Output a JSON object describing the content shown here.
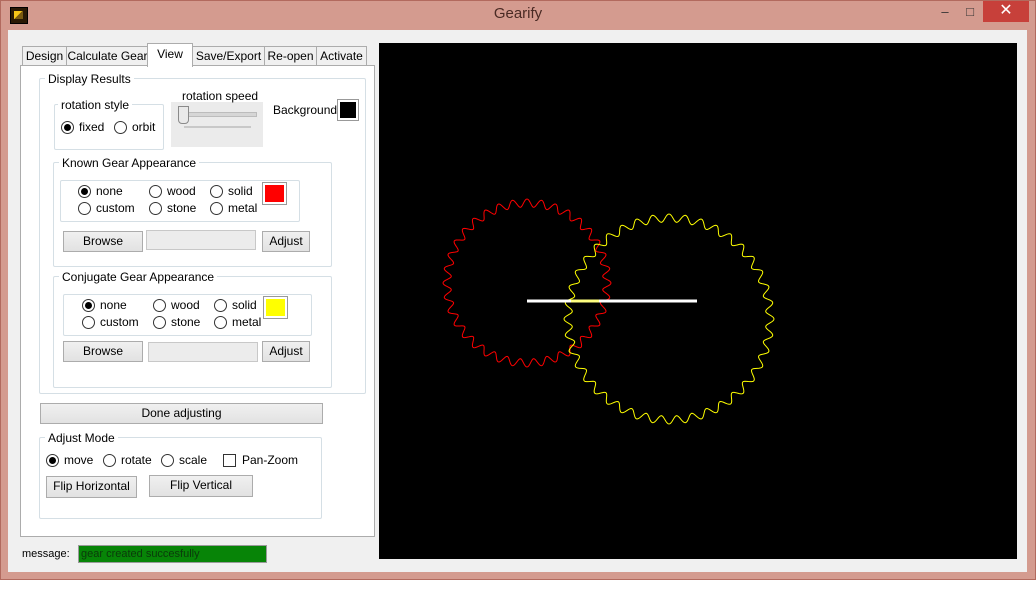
{
  "window": {
    "title": "Gearify"
  },
  "titlebar": {
    "minimize_glyph": "–",
    "maximize_glyph": "□",
    "close_glyph": "✕"
  },
  "tabs": [
    {
      "label": "Design"
    },
    {
      "label": "Calculate Gear"
    },
    {
      "label": "View",
      "active": true
    },
    {
      "label": "Save/Export"
    },
    {
      "label": "Re-open"
    },
    {
      "label": "Activate"
    }
  ],
  "display_results": {
    "label": "Display Results",
    "rotation_style": {
      "label": "rotation style",
      "options": [
        "fixed",
        "orbit"
      ],
      "selected": "fixed"
    },
    "rotation_speed": {
      "label": "rotation speed",
      "value": 0
    },
    "background": {
      "label": "Background",
      "color": "#000000"
    }
  },
  "known_gear": {
    "label": "Known Gear Appearance",
    "options": [
      "none",
      "wood",
      "solid",
      "custom",
      "stone",
      "metal"
    ],
    "selected": "none",
    "color": "#ff0000",
    "browse_label": "Browse",
    "path_value": "",
    "adjust_label": "Adjust"
  },
  "conjugate_gear": {
    "label": "Conjugate Gear Appearance",
    "options": [
      "none",
      "wood",
      "solid",
      "custom",
      "stone",
      "metal"
    ],
    "selected": "none",
    "color": "#ffff00",
    "browse_label": "Browse",
    "path_value": "",
    "adjust_label": "Adjust"
  },
  "done_adjusting_label": "Done adjusting",
  "adjust_mode": {
    "label": "Adjust Mode",
    "options": [
      "move",
      "rotate",
      "scale"
    ],
    "selected": "move",
    "pan_zoom_label": "Pan-Zoom",
    "pan_zoom_checked": false,
    "flip_h_label": "Flip Horizontal",
    "flip_v_label": "Flip Vertical"
  },
  "message": {
    "label": "message:",
    "text": "gear created succesfully",
    "color": "#078407"
  },
  "view": {
    "background": "#000000",
    "known_gear": {
      "color": "#ff0000",
      "teeth": 36
    },
    "conjugate_gear": {
      "color": "#ffff00",
      "teeth": 40
    }
  }
}
